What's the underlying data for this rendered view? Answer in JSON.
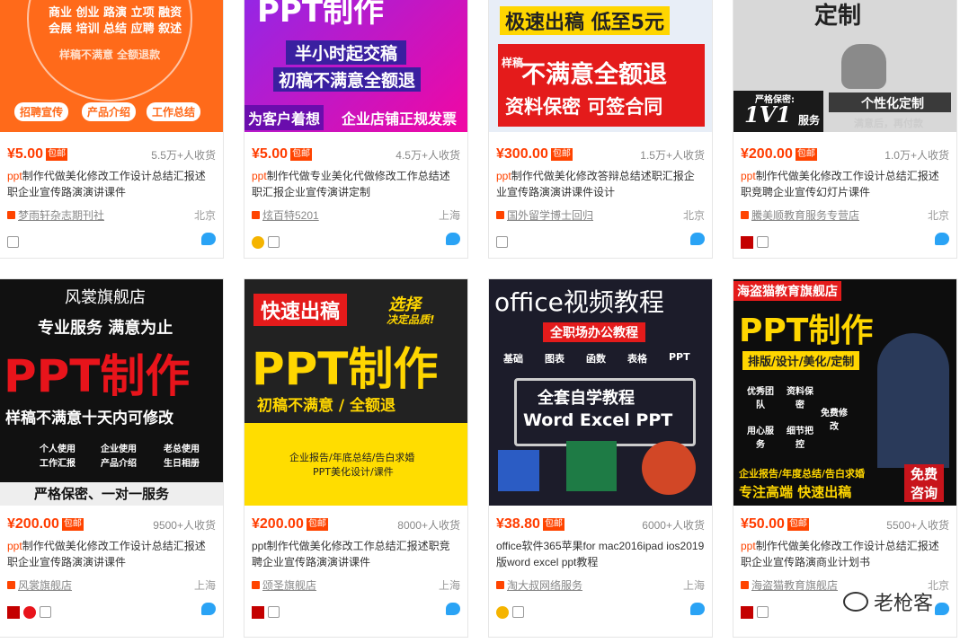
{
  "products": [
    {
      "price": "¥5.00",
      "tag": "包邮",
      "sales": "5.5万+人收货",
      "title_kw": "ppt",
      "title_rest": "制作代做美化修改工作设计总结汇报述职企业宣传路演演讲课件",
      "shop": "梦雨轩杂志期刊社",
      "location": "北京",
      "thumb": {
        "lines": [
          "商业 创业 路演 立项 融资",
          "会展 培训 总结 应聘 叙述",
          "样稿不满意 全额退款"
        ],
        "chips": [
          "招聘宣传",
          "产品介绍",
          "工作总结"
        ]
      }
    },
    {
      "price": "¥5.00",
      "tag": "包邮",
      "sales": "4.5万+人收货",
      "title_kw": "ppt",
      "title_rest": "制作代做专业美化代做修改工作总结述职汇报企业宣传演讲定制",
      "shop": "炫百特5201",
      "location": "上海",
      "thumb": {
        "lines": [
          "PPT制作",
          "半小时起交稿",
          "初稿不满意全额退",
          "为客户着想",
          "企业店铺正规发票"
        ]
      }
    },
    {
      "price": "¥300.00",
      "tag": "包邮",
      "sales": "1.5万+人收货",
      "title_kw": "ppt",
      "title_rest": "制作代做美化修改答辩总结述职汇报企业宣传路演演讲课件设计",
      "shop": "国外留学博士回归",
      "location": "北京",
      "thumb": {
        "lines": [
          "极速出稿 低至5元",
          "样稿",
          "不满意全额退",
          "资料保密 可签合同"
        ]
      }
    },
    {
      "price": "¥200.00",
      "tag": "包邮",
      "sales": "1.0万+人收货",
      "title_kw": "ppt",
      "title_rest": "制作代做美化修改工作设计总结汇报述职竞聘企业宣传幻灯片课件",
      "shop": "騰美顺教育服务专营店",
      "location": "北京",
      "thumb": {
        "lines": [
          "定制",
          "严格保密:",
          "1V1",
          "服务",
          "个性化定制",
          "满意后，再付款"
        ]
      }
    },
    {
      "price": "¥200.00",
      "tag": "包邮",
      "sales": "9500+人收货",
      "title_kw": "ppt",
      "title_rest": "制作代做美化修改工作设计总结汇报述职企业宣传路演演讲课件",
      "shop": "风裳旗舰店",
      "location": "上海",
      "thumb": {
        "lines": [
          "风裳旗舰店",
          "专业服务 满意为止",
          "PPT制作",
          "样稿不满意十天内可修改",
          "个人使用",
          "企业使用",
          "老总使用",
          "工作汇报",
          "产品介绍",
          "生日相册",
          "严格保密、一对一服务"
        ]
      }
    },
    {
      "price": "¥200.00",
      "tag": "包邮",
      "sales": "8000+人收货",
      "title_kw": "",
      "title_rest": "ppt制作代做美化修改工作总结汇报述职竞聘企业宣传路演演讲课件",
      "shop": "颂圣旗舰店",
      "location": "上海",
      "thumb": {
        "lines": [
          "快速出稿",
          "选择",
          "决定品质!",
          "PPT制作",
          "初稿不满意 / 全额退",
          "企业报告/年底总结/告白求婚",
          "PPT美化设计/课件"
        ]
      }
    },
    {
      "price": "¥38.80",
      "tag": "包邮",
      "sales": "6000+人收货",
      "title_kw": "ppt",
      "title_rest": "office软件365苹果for mac2016ipad ios2019版word excel ppt教程",
      "shop": "淘大叔网络服务",
      "location": "上海",
      "thumb": {
        "lines": [
          "office视频教程",
          "全职场办公教程",
          "基础",
          "图表",
          "函数",
          "表格",
          "PPT",
          "全套自学教程",
          "Word Excel PPT"
        ]
      }
    },
    {
      "price": "¥50.00",
      "tag": "包邮",
      "sales": "5500+人收货",
      "title_kw": "ppt",
      "title_rest": "制作代做美化修改工作设计总结汇报述职企业宣传路演商业计划书",
      "shop": "海盗猫教育旗舰店",
      "location": "北京",
      "thumb": {
        "lines": [
          "海盗猫教育旗舰店",
          "PPT制作",
          "排版/设计/美化/定制",
          "优秀团队",
          "资料保密",
          "免费修改",
          "用心服务",
          "细节把控",
          "企业报告/年度总结/告白求婚",
          "专注高端 快速出稿",
          "免费咨询"
        ]
      }
    }
  ],
  "watermark": "老枪客",
  "colors": {
    "price": "#ff3c00",
    "accent": "#ff4400"
  }
}
